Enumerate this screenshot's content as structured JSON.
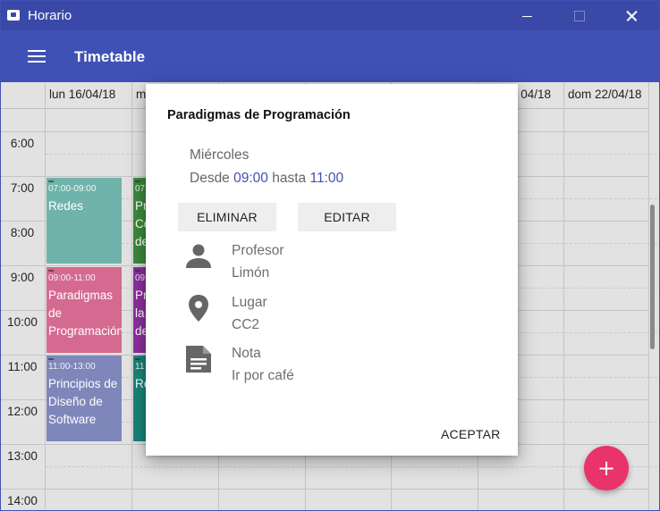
{
  "window": {
    "title": "Horario"
  },
  "appbar": {
    "title": "Timetable"
  },
  "timetable": {
    "days": [
      "lun 16/04/18",
      "ma",
      "",
      "",
      "",
      "04/18",
      "dom 22/04/18"
    ],
    "hours": [
      "6:00",
      "7:00",
      "8:00",
      "9:00",
      "10:00",
      "11:00",
      "12:00",
      "13:00",
      "14:00"
    ],
    "events": [
      {
        "time": "07:00-09:00",
        "name": "Redes",
        "color": "#80cbc4"
      },
      {
        "time": "09:00-11:00",
        "name": "Paradigmas de Programación",
        "color": "#f06292"
      },
      {
        "time": "11:00-13:00",
        "name": "Principios de Diseño de Software",
        "color": "#7986cb"
      },
      {
        "time": "07",
        "name": "Pr Co de",
        "color": "#43a047"
      },
      {
        "time": "09",
        "name": "Pr la de",
        "color": "#9c27b0"
      },
      {
        "time": "11",
        "name": "Re",
        "color": "#009688"
      }
    ]
  },
  "dialog": {
    "title": "Paradigmas de Programación",
    "day": "Miércoles",
    "from_label": "Desde",
    "start": "09:00",
    "to_label": "hasta",
    "end": "11:00",
    "delete_label": "ELIMINAR",
    "edit_label": "EDITAR",
    "professor_label": "Profesor",
    "professor_value": "Limón",
    "place_label": "Lugar",
    "place_value": "CC2",
    "note_label": "Nota",
    "note_value": "Ir por café",
    "accept_label": "ACEPTAR",
    "icons": [
      "person-icon",
      "location-pin-icon",
      "note-icon"
    ]
  },
  "fab": {
    "label": "+",
    "color": "#e8336b"
  },
  "colors": {
    "primary": "#3f51b5",
    "titlebar": "#3a49a8",
    "accent": "#e8336b"
  }
}
